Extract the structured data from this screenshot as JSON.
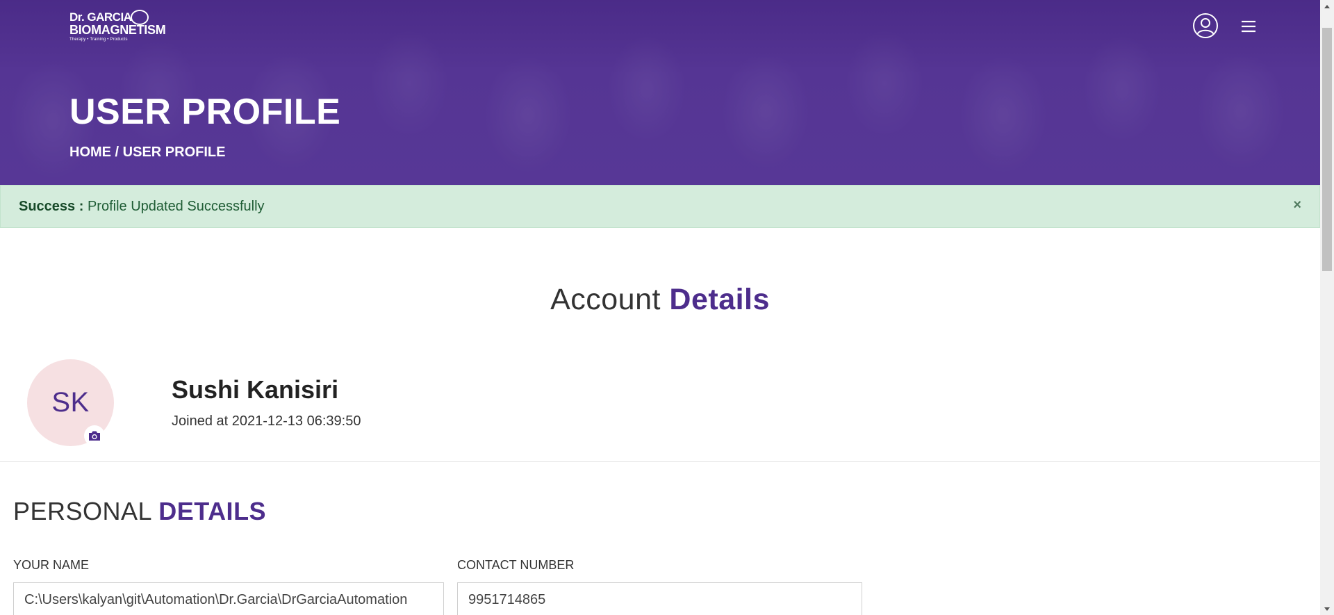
{
  "header": {
    "logo": {
      "line1": "Dr. GARCIA",
      "line2": "BIOMAGNETISM",
      "tagline": "Therapy • Training • Products"
    },
    "user_icon": "user-circle-icon",
    "menu_icon": "hamburger-menu-icon"
  },
  "hero": {
    "title": "USER PROFILE",
    "breadcrumb": "HOME / USER PROFILE"
  },
  "alert": {
    "label": "Success :",
    "message": " Profile Updated Successfully",
    "close": "×",
    "color": "#d4ecdc"
  },
  "account": {
    "heading_light": "Account ",
    "heading_bold": "Details"
  },
  "profile": {
    "initials": "SK",
    "name": "Sushi Kanisiri",
    "joined": "Joined at 2021-12-13 06:39:50",
    "camera_icon": "camera-icon"
  },
  "personal": {
    "heading_light": "PERSONAL ",
    "heading_bold": "DETAILS",
    "fields": {
      "name_label": "YOUR NAME",
      "name_value": "C:\\Users\\kalyan\\git\\Automation\\Dr.Garcia\\DrGarciaAutomation",
      "contact_label": "CONTACT NUMBER",
      "contact_value": "9951714865"
    }
  },
  "colors": {
    "brand_purple": "#4d2d8c",
    "hero_overlay": "#5c3d9b"
  }
}
